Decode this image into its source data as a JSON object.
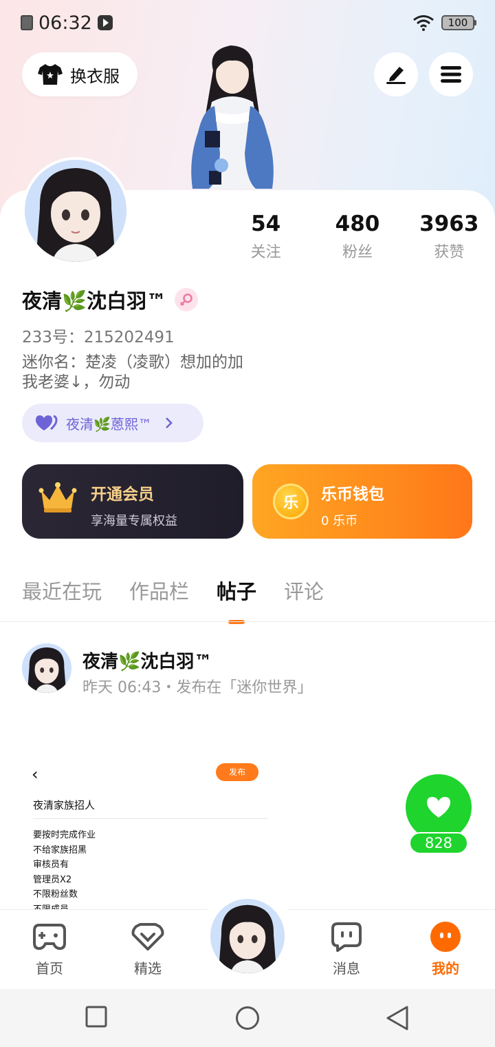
{
  "status_bar": {
    "time": "06:32",
    "battery": "100"
  },
  "header": {
    "outfit_label": "换衣服",
    "edit_icon": "pen-icon",
    "menu_icon": "menu-icon"
  },
  "profile": {
    "stats": [
      {
        "value": "54",
        "label": "关注"
      },
      {
        "value": "480",
        "label": "粉丝"
      },
      {
        "value": "3963",
        "label": "获赞"
      }
    ],
    "name": "夜清🌿沈白羽™",
    "gender_icon": "female-icon",
    "uid": "233号：215202491",
    "bio_line1": "迷你名：楚凌（凌歌）想加的加",
    "bio_line2": "我老婆↓，勿动",
    "partner": "夜清🌿蒽熙™"
  },
  "cards": {
    "vip": {
      "title": "开通会员",
      "subtitle": "享海量专属权益"
    },
    "wallet": {
      "title": "乐币钱包",
      "subtitle": "0 乐币",
      "coin": "乐"
    }
  },
  "tabs": [
    "最近在玩",
    "作品栏",
    "帖子",
    "评论"
  ],
  "active_tab": "帖子",
  "post": {
    "author": "夜清🌿沈白羽™",
    "meta": "昨天 06:43・发布在「迷你世界」",
    "screenshot": {
      "publish": "发布",
      "title": "夜清家族招人",
      "lines": [
        "要按时完成作业",
        "不给家族招黑",
        "审核员有",
        "管理员X2",
        "不限粉丝数",
        "不限成员"
      ]
    },
    "likes": "828"
  },
  "bottom_nav": [
    {
      "label": "首页",
      "icon": "gamepad-icon"
    },
    {
      "label": "精选",
      "icon": "heart-diamond-icon"
    },
    {
      "label": "消息",
      "icon": "chat-icon"
    },
    {
      "label": "我的",
      "icon": "profile-dots-icon"
    }
  ],
  "colors": {
    "accent": "#ff7a1a",
    "like_green": "#1fd42d",
    "vip_bg": "#2b2735",
    "wallet_bg": "#ff8b1c"
  }
}
